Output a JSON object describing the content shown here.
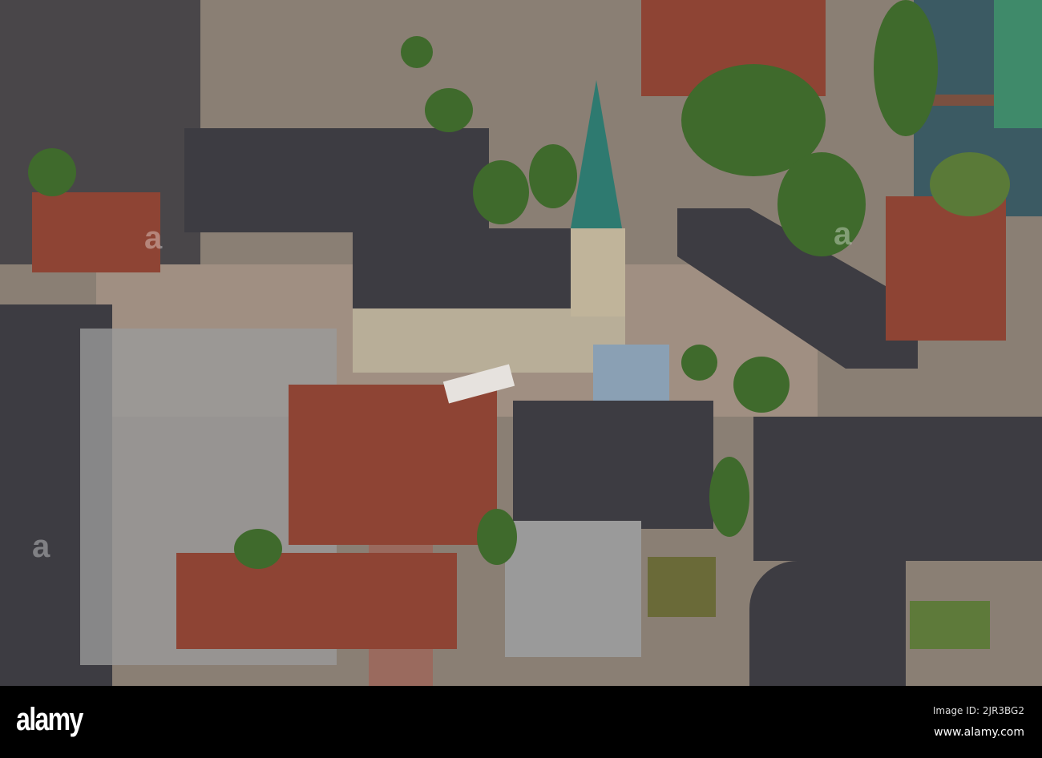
{
  "footer": {
    "logo": "alamy",
    "image_id": "Image ID: 2JR3BG2",
    "url": "www.alamy.com"
  },
  "watermark": "alamy"
}
